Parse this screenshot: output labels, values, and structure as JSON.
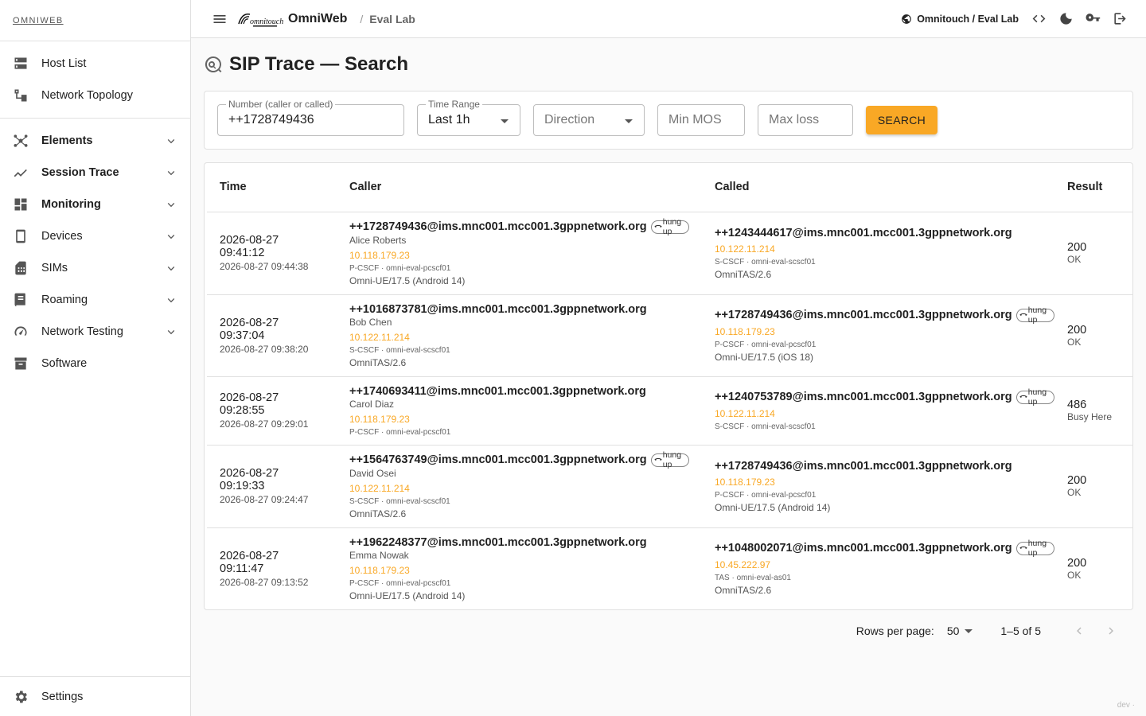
{
  "sidebar": {
    "brand": "OMNIWEB",
    "top_items": [
      {
        "label": "Host List",
        "icon": "server-icon"
      },
      {
        "label": "Network Topology",
        "icon": "topology-icon"
      }
    ],
    "groups": [
      {
        "label": "Elements",
        "icon": "hub-icon",
        "bold": true
      },
      {
        "label": "Session Trace",
        "icon": "trending-icon",
        "bold": true
      },
      {
        "label": "Monitoring",
        "icon": "dashboard-icon",
        "bold": true
      },
      {
        "label": "Devices",
        "icon": "phone-icon",
        "bold": false
      },
      {
        "label": "SIMs",
        "icon": "sim-icon",
        "bold": false
      },
      {
        "label": "Roaming",
        "icon": "book-icon",
        "bold": false
      },
      {
        "label": "Network Testing",
        "icon": "speed-icon",
        "bold": false
      }
    ],
    "software": {
      "label": "Software",
      "icon": "archive-icon"
    },
    "settings": {
      "label": "Settings",
      "icon": "gear-icon"
    }
  },
  "topbar": {
    "app_name": "OmniWeb",
    "crumb_sep": "/",
    "crumb": "Eval Lab",
    "tenant": "Omnitouch / Eval Lab"
  },
  "page": {
    "title": "SIP Trace — Search"
  },
  "filters": {
    "number_label": "Number (caller or called)",
    "number_value": "++1728749436",
    "time_label": "Time Range",
    "time_value": "Last 1h",
    "direction_placeholder": "Direction",
    "min_mos_placeholder": "Min MOS",
    "max_loss_placeholder": "Max loss",
    "search_label": "SEARCH"
  },
  "table": {
    "headers": {
      "time": "Time",
      "caller": "Caller",
      "called": "Called",
      "result": "Result"
    },
    "rows": [
      {
        "start": "2026-08-27 09:41:12",
        "end": "2026-08-27 09:44:38",
        "caller": {
          "uri": "++1728749436@ims.mnc001.mcc001.3gppnetwork.org",
          "hung": "hung up",
          "name": "Alice Roberts",
          "ip": "10.118.179.23",
          "role": "P-CSCF · omni-eval-pcscf01",
          "ua": "Omni-UE/17.5 (Android 14)"
        },
        "called": {
          "uri": "++1243444617@ims.mnc001.mcc001.3gppnetwork.org",
          "hung": "",
          "name": "",
          "ip": "10.122.11.214",
          "role": "S-CSCF · omni-eval-scscf01",
          "ua": "OmniTAS/2.6"
        },
        "code": "200",
        "reason": "OK"
      },
      {
        "start": "2026-08-27 09:37:04",
        "end": "2026-08-27 09:38:20",
        "caller": {
          "uri": "++1016873781@ims.mnc001.mcc001.3gppnetwork.org",
          "hung": "",
          "name": "Bob Chen",
          "ip": "10.122.11.214",
          "role": "S-CSCF · omni-eval-scscf01",
          "ua": "OmniTAS/2.6"
        },
        "called": {
          "uri": "++1728749436@ims.mnc001.mcc001.3gppnetwork.org",
          "hung": "hung up",
          "name": "",
          "ip": "10.118.179.23",
          "role": "P-CSCF · omni-eval-pcscf01",
          "ua": "Omni-UE/17.5 (iOS 18)"
        },
        "code": "200",
        "reason": "OK"
      },
      {
        "start": "2026-08-27 09:28:55",
        "end": "2026-08-27 09:29:01",
        "caller": {
          "uri": "++1740693411@ims.mnc001.mcc001.3gppnetwork.org",
          "hung": "",
          "name": "Carol Diaz",
          "ip": "10.118.179.23",
          "role": "P-CSCF · omni-eval-pcscf01",
          "ua": ""
        },
        "called": {
          "uri": "++1240753789@ims.mnc001.mcc001.3gppnetwork.org",
          "hung": "hung up",
          "name": "",
          "ip": "10.122.11.214",
          "role": "S-CSCF · omni-eval-scscf01",
          "ua": ""
        },
        "code": "486",
        "reason": "Busy Here"
      },
      {
        "start": "2026-08-27 09:19:33",
        "end": "2026-08-27 09:24:47",
        "caller": {
          "uri": "++1564763749@ims.mnc001.mcc001.3gppnetwork.org",
          "hung": "hung up",
          "name": "David Osei",
          "ip": "10.122.11.214",
          "role": "S-CSCF · omni-eval-scscf01",
          "ua": "OmniTAS/2.6"
        },
        "called": {
          "uri": "++1728749436@ims.mnc001.mcc001.3gppnetwork.org",
          "hung": "",
          "name": "",
          "ip": "10.118.179.23",
          "role": "P-CSCF · omni-eval-pcscf01",
          "ua": "Omni-UE/17.5 (Android 14)"
        },
        "code": "200",
        "reason": "OK"
      },
      {
        "start": "2026-08-27 09:11:47",
        "end": "2026-08-27 09:13:52",
        "caller": {
          "uri": "++1962248377@ims.mnc001.mcc001.3gppnetwork.org",
          "hung": "",
          "name": "Emma Nowak",
          "ip": "10.118.179.23",
          "role": "P-CSCF · omni-eval-pcscf01",
          "ua": "Omni-UE/17.5 (Android 14)"
        },
        "called": {
          "uri": "++1048002071@ims.mnc001.mcc001.3gppnetwork.org",
          "hung": "hung up",
          "name": "",
          "ip": "10.45.222.97",
          "role": "TAS · omni-eval-as01",
          "ua": "OmniTAS/2.6"
        },
        "code": "200",
        "reason": "OK"
      }
    ]
  },
  "pager": {
    "rows_per_page_label": "Rows per page:",
    "rows_per_page_value": "50",
    "range": "1–5 of 5"
  },
  "footer": {
    "tag": "dev ·"
  },
  "colors": {
    "accent": "#f9a825",
    "ip": "#f9a825",
    "text": "#212121"
  }
}
